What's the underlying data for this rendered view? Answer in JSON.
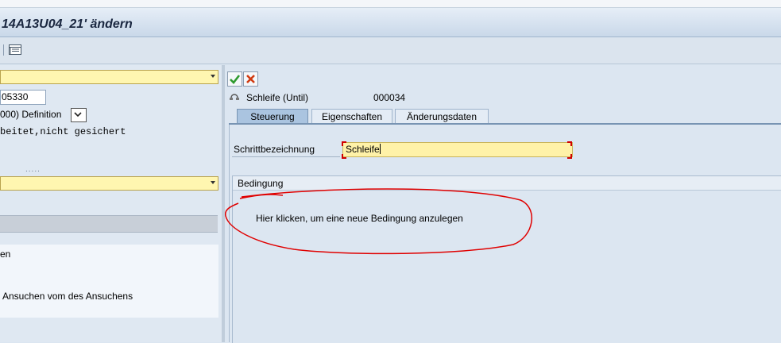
{
  "window": {
    "title": "14A13U04_21' ändern"
  },
  "left": {
    "number_field": "05330",
    "definition_select": "000) Definition",
    "status_text": "beitet,nicht gesichert",
    "dots": ".....",
    "list_items": [
      "en",
      "Ansuchen vom des Ansuchens"
    ]
  },
  "right": {
    "loop_label": "Schleife (Until)",
    "loop_id": "000034",
    "tabs": [
      "Steuerung",
      "Eigenschaften",
      "Änderungsdaten"
    ],
    "step_label": "Schrittbezeichnung",
    "step_value": "Schleife",
    "group_title": "Bedingung",
    "condition_link": "Hier klicken, um eine neue Bedingung anzulegen"
  },
  "colors": {
    "annotation": "#e00000",
    "active_tab": "#aac4e0",
    "required_field": "#fff2a8"
  },
  "icons": [
    "table-icon",
    "confirm-icon",
    "cancel-icon",
    "loop-icon",
    "dropdown-icon"
  ]
}
